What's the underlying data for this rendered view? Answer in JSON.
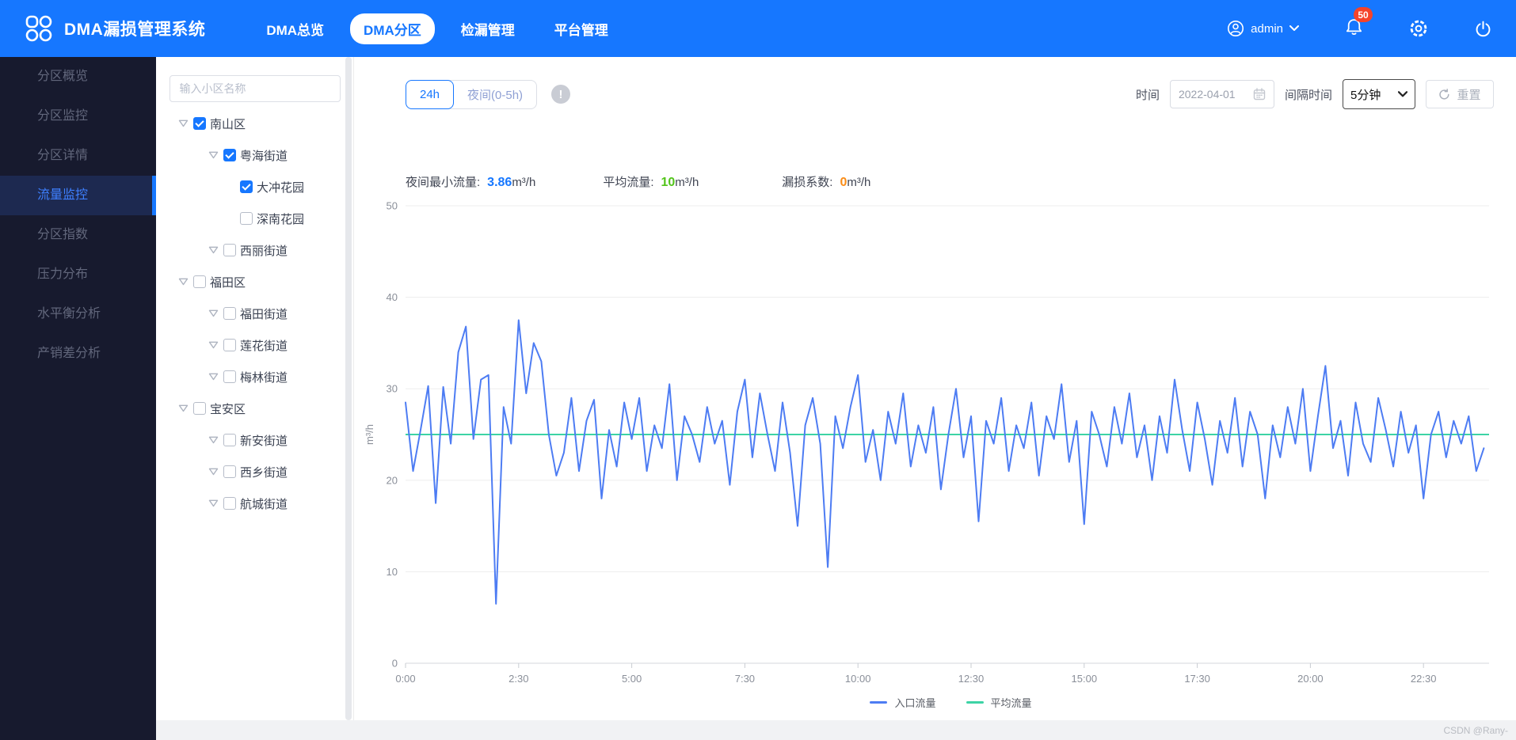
{
  "app": {
    "title": "DMA漏损管理系统"
  },
  "header": {
    "nav": [
      "DMA总览",
      "DMA分区",
      "检漏管理",
      "平台管理"
    ],
    "nav_active_index": 1,
    "user_name": "admin",
    "badge_count": "50"
  },
  "sidebar": {
    "items": [
      "分区概览",
      "分区监控",
      "分区详情",
      "流量监控",
      "分区指数",
      "压力分布",
      "水平衡分析",
      "产销差分析"
    ],
    "active_index": 3
  },
  "tree": {
    "placeholder": "输入小区名称",
    "nodes": [
      {
        "label": "南山区",
        "level": 1,
        "arrow": true,
        "checked": true
      },
      {
        "label": "粤海街道",
        "level": 2,
        "arrow": true,
        "checked": true
      },
      {
        "label": "大冲花园",
        "level": 3,
        "arrow": false,
        "checked": true
      },
      {
        "label": "深南花园",
        "level": 3,
        "arrow": false,
        "checked": false
      },
      {
        "label": "西丽街道",
        "level": 2,
        "arrow": true,
        "checked": false
      },
      {
        "label": "福田区",
        "level": 1,
        "arrow": true,
        "checked": false
      },
      {
        "label": "福田街道",
        "level": 2,
        "arrow": true,
        "checked": false
      },
      {
        "label": "莲花街道",
        "level": 2,
        "arrow": true,
        "checked": false
      },
      {
        "label": "梅林街道",
        "level": 2,
        "arrow": true,
        "checked": false
      },
      {
        "label": "宝安区",
        "level": 1,
        "arrow": true,
        "checked": false
      },
      {
        "label": "新安街道",
        "level": 2,
        "arrow": true,
        "checked": false
      },
      {
        "label": "西乡街道",
        "level": 2,
        "arrow": true,
        "checked": false
      },
      {
        "label": "航城街道",
        "level": 2,
        "arrow": true,
        "checked": false
      }
    ]
  },
  "controls": {
    "tabs": [
      {
        "label": "24h",
        "active": true
      },
      {
        "label": "夜间(0-5h)",
        "active": false
      }
    ],
    "info_glyph": "!",
    "date_label": "时间",
    "date_value": "2022-04-01",
    "interval_label": "间隔时间",
    "interval_value": "5分钟",
    "reset_label": "重置"
  },
  "stats": [
    {
      "label": "夜间最小流量:",
      "value": "3.86",
      "unit": "m³/h",
      "color": "#1677ff"
    },
    {
      "label": "平均流量:",
      "value": "10",
      "unit": "m³/h",
      "color": "#52c41a"
    },
    {
      "label": "漏损系数:",
      "value": "0",
      "unit": "m³/h",
      "color": "#fa8c16"
    }
  ],
  "chart_data": {
    "type": "line",
    "ylabel": "m³/h",
    "ylim": [
      0,
      50
    ],
    "y_ticks": [
      0,
      10,
      20,
      30,
      40,
      50
    ],
    "x_labels": [
      "0:00",
      "2:30",
      "5:00",
      "7:30",
      "10:00",
      "12:30",
      "15:00",
      "17:30",
      "20:00",
      "22:30"
    ],
    "sample_interval_minutes": 10,
    "grid": true,
    "legend_position": "bottom",
    "series": [
      {
        "name": "入口流量",
        "color": "#4d7cf3",
        "values": [
          28.5,
          21,
          25.5,
          30.3,
          17.5,
          30.2,
          24,
          34,
          36.8,
          24.5,
          31,
          31.5,
          6.5,
          28,
          24,
          37.5,
          29.5,
          35,
          33,
          25,
          20.5,
          23,
          29,
          21,
          26.5,
          28.8,
          18,
          25.5,
          21.5,
          28.5,
          24.5,
          29,
          21,
          26,
          23.5,
          30.5,
          20,
          27,
          25,
          22,
          28,
          24,
          26.5,
          19.5,
          27.5,
          31,
          22.5,
          29.5,
          25,
          21,
          28.5,
          23,
          15,
          26,
          29,
          24,
          10.5,
          27,
          23.5,
          28,
          31.5,
          22,
          25.5,
          20,
          27.5,
          24,
          29.5,
          21.5,
          26,
          23,
          28,
          19,
          25,
          30,
          22.5,
          27,
          15.5,
          26.5,
          24,
          29,
          21,
          26,
          23.5,
          28.5,
          20.5,
          27,
          24.5,
          30.5,
          22,
          26.5,
          15.2,
          27.5,
          25,
          21.5,
          28,
          24,
          29.5,
          22.5,
          26,
          20,
          27,
          23,
          31,
          25.5,
          21,
          28.5,
          24.5,
          19.5,
          26.5,
          23,
          29,
          21.5,
          27.5,
          25,
          18,
          26,
          22.5,
          28,
          24,
          30,
          21,
          27,
          32.5,
          23.5,
          26.5,
          20.5,
          28.5,
          24,
          22,
          29,
          25.5,
          21.5,
          27.5,
          23,
          26,
          18,
          25,
          27.5,
          22.5,
          26.5,
          24,
          27,
          21,
          23.5
        ]
      },
      {
        "name": "平均流量",
        "color": "#3dd3a5",
        "constant": 25
      }
    ]
  },
  "watermark": "CSDN @Rany-",
  "colors": {
    "header_bg": "#1677ff",
    "sidebar_bg": "#171a2e",
    "badge": "#f5432a",
    "accent": "#1677ff"
  }
}
